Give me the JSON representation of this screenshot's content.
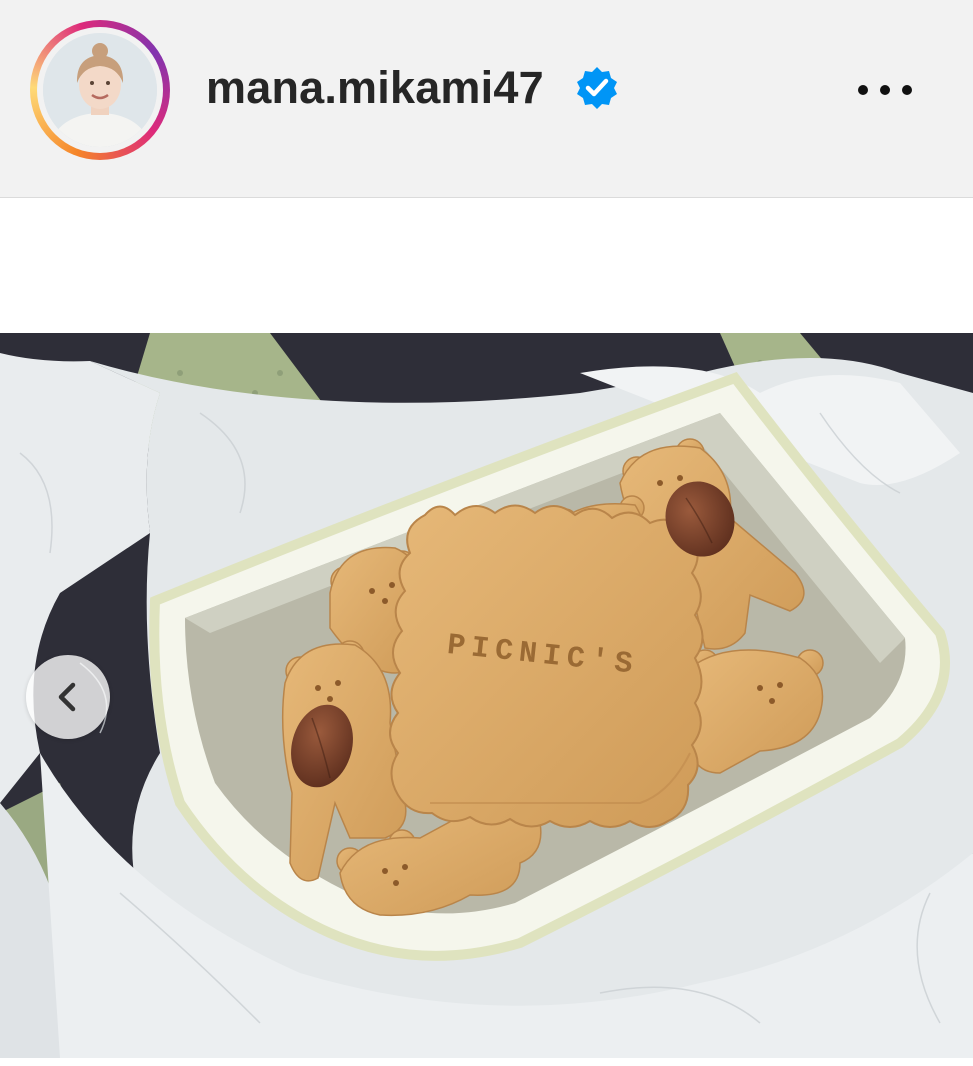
{
  "post": {
    "username": "mana.mikami47",
    "verified": true,
    "avatar_icon": "profile-photo",
    "more_icon": "more-horizontal-icon"
  },
  "photo": {
    "cookie_stamp_text": "PICNIC'S",
    "nav_prev_icon": "chevron-left-icon"
  },
  "colors": {
    "header_bg": "#f2f2f2",
    "verified_blue": "#0095f6",
    "text": "#262626"
  }
}
